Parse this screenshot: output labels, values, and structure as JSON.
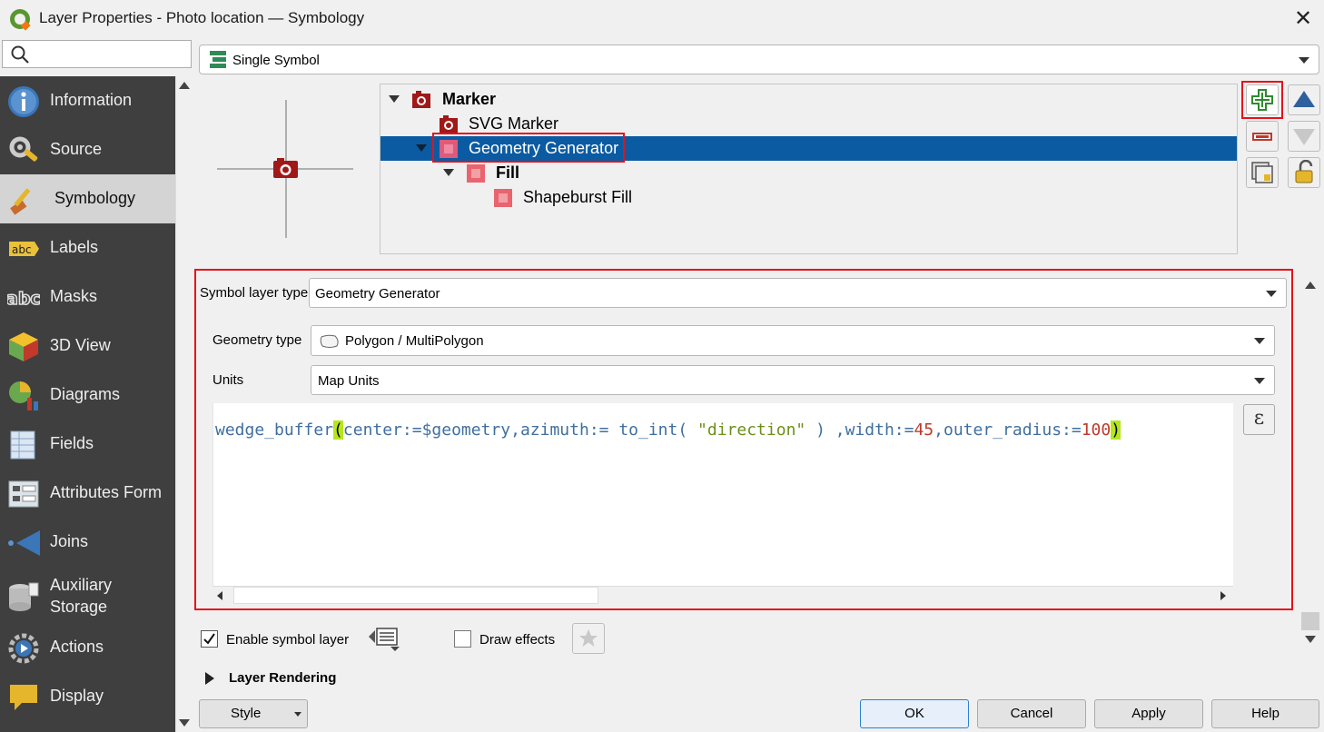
{
  "window": {
    "title": "Layer Properties - Photo location — Symbology",
    "close": "✕"
  },
  "sidebar": {
    "items": [
      {
        "label": "Information",
        "icon": "information-icon"
      },
      {
        "label": "Source",
        "icon": "source-icon"
      },
      {
        "label": "Symbology",
        "icon": "symbology-icon",
        "selected": true
      },
      {
        "label": "Labels",
        "icon": "labels-icon"
      },
      {
        "label": "Masks",
        "icon": "masks-icon"
      },
      {
        "label": "3D View",
        "icon": "3d-view-icon"
      },
      {
        "label": "Diagrams",
        "icon": "diagrams-icon"
      },
      {
        "label": "Fields",
        "icon": "fields-icon"
      },
      {
        "label": "Attributes Form",
        "icon": "attributes-form-icon"
      },
      {
        "label": "Joins",
        "icon": "joins-icon"
      },
      {
        "label": "Auxiliary",
        "label2": "Storage",
        "icon": "auxiliary-storage-icon"
      },
      {
        "label": "Actions",
        "icon": "actions-icon"
      },
      {
        "label": "Display",
        "icon": "display-icon"
      }
    ],
    "abc1": "abc",
    "abc2": "abc"
  },
  "renderer": {
    "value": "Single Symbol"
  },
  "tree": {
    "items": [
      {
        "label": "Marker"
      },
      {
        "label": "SVG Marker"
      },
      {
        "label": "Geometry Generator"
      },
      {
        "label": "Fill"
      },
      {
        "label": "Shapeburst Fill"
      }
    ]
  },
  "symbol_layer": {
    "type_label": "Symbol layer type",
    "type_value": "Geometry Generator",
    "geom_label": "Geometry type",
    "geom_value": "Polygon / MultiPolygon",
    "units_label": "Units",
    "units_value": "Map Units",
    "expression": {
      "func": "wedge_buffer",
      "open": "(",
      "p1": "center:=$geometry,azimuth:= to_int( ",
      "str": "\"direction\"",
      "p2": " ) ,width:=",
      "n1": "45",
      "p3": ",outer_radius:=",
      "n2": "100",
      "close": ")"
    },
    "epsilon": "ε"
  },
  "options": {
    "enable_label": "Enable symbol layer",
    "enable_checked": true,
    "effects_label": "Draw effects",
    "effects_checked": false,
    "rendering_label": "Layer Rendering"
  },
  "buttons": {
    "style": "Style",
    "ok": "OK",
    "cancel": "Cancel",
    "apply": "Apply",
    "help": "Help"
  },
  "colors": {
    "accent_red": "#e8111a",
    "selection_blue": "#0a5ba2",
    "sidebar_bg": "#3f3f3f"
  }
}
